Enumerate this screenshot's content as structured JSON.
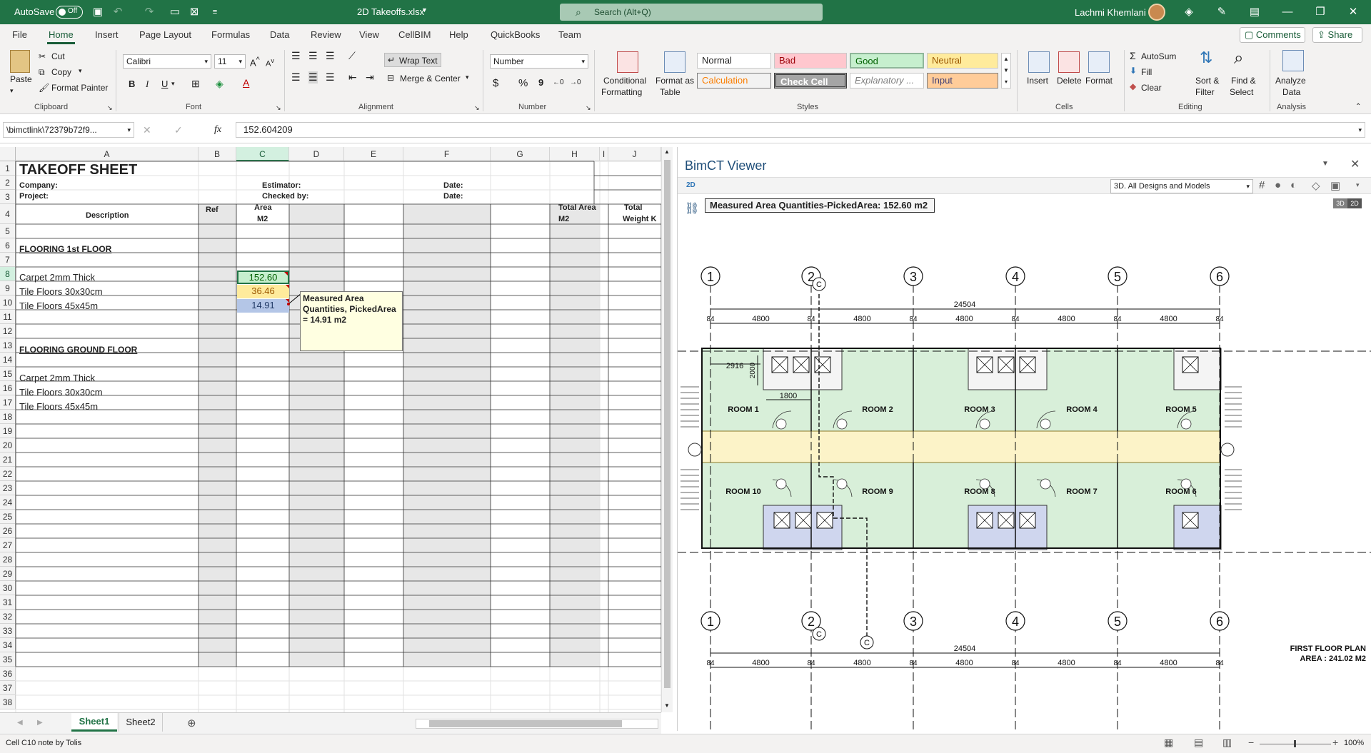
{
  "titlebar": {
    "autosave_label": "AutoSave",
    "autosave_state": "Off",
    "filename": "2D Takeoffs.xlsx",
    "search_placeholder": "Search (Alt+Q)",
    "user_name": "Lachmi Khemlani"
  },
  "ribbon_tabs": [
    "File",
    "Home",
    "Insert",
    "Page Layout",
    "Formulas",
    "Data",
    "Review",
    "View",
    "CellBIM",
    "Help",
    "QuickBooks",
    "Team"
  ],
  "ribbon_right": {
    "comments": "Comments",
    "share": "Share"
  },
  "clipboard": {
    "paste": "Paste",
    "cut": "Cut",
    "copy": "Copy",
    "format_painter": "Format Painter",
    "group": "Clipboard"
  },
  "font": {
    "name": "Calibri",
    "size": "11",
    "bold": "B",
    "italic": "I",
    "underline": "U",
    "group": "Font"
  },
  "alignment": {
    "wrap_text": "Wrap Text",
    "merge_center": "Merge & Center",
    "group": "Alignment"
  },
  "number": {
    "format": "Number",
    "currency": "$",
    "percent": "%",
    "comma": "9",
    "group": "Number"
  },
  "styles": {
    "conditional_1": "Conditional",
    "conditional_2": "Formatting",
    "format_as_1": "Format as",
    "format_as_2": "Table",
    "normal": "Normal",
    "bad": "Bad",
    "good": "Good",
    "neutral": "Neutral",
    "calculation": "Calculation",
    "check_cell": "Check Cell",
    "explanatory": "Explanatory ...",
    "input": "Input",
    "group": "Styles"
  },
  "cells_group": {
    "insert": "Insert",
    "delete": "Delete",
    "format": "Format",
    "group": "Cells"
  },
  "editing": {
    "autosum": "AutoSum",
    "fill": "Fill",
    "clear": "Clear",
    "sort_1": "Sort &",
    "sort_2": "Filter",
    "find_1": "Find &",
    "find_2": "Select",
    "group": "Editing"
  },
  "analysis": {
    "analyze_1": "Analyze",
    "analyze_2": "Data",
    "group": "Analysis"
  },
  "formula_bar": {
    "name_box": "\\bimctlink\\72379b72f9...",
    "fx": "fx",
    "value": "152.604209"
  },
  "columns": [
    "A",
    "B",
    "C",
    "D",
    "E",
    "F",
    "G",
    "H",
    "I",
    "J"
  ],
  "rows": [
    "1",
    "2",
    "3",
    "4",
    "5",
    "6",
    "7",
    "8",
    "9",
    "10",
    "11",
    "12",
    "13",
    "14",
    "15",
    "16",
    "17",
    "18",
    "19",
    "20",
    "21",
    "22",
    "23",
    "24",
    "25",
    "26",
    "27",
    "28",
    "29",
    "30",
    "31",
    "32",
    "33",
    "34",
    "35",
    "36",
    "37",
    "38"
  ],
  "sheet": {
    "title": "TAKEOFF SHEET",
    "company": "Company:",
    "project": "Project:",
    "estimator": "Estimator:",
    "checked_by": "Checked by:",
    "date1": "Date:",
    "date2": "Date:",
    "hdr_description": "Description",
    "hdr_ref": "Ref",
    "hdr_area_1": "Area",
    "hdr_area_2": "M2",
    "hdr_total_area_1": "Total Area",
    "hdr_total_area_2": "M2",
    "hdr_total_weight_1": "Total",
    "hdr_total_weight_2": "Weight K",
    "section1": "FLOORING 1st FLOOR",
    "item1": "Carpet 2mm Thick",
    "item2": "Tile Floors 30x30cm",
    "item3": "Tile Floors 45x45m",
    "val1": "152.60",
    "val2": "36.46",
    "val3": "14.91",
    "section2": "FLOORING GROUND FLOOR",
    "item4": "Carpet 2mm Thick",
    "item5": "Tile Floors 30x30cm",
    "item6": "Tile Floors 45x45m",
    "comment": "Measured Area Quantities, PickedArea = 14.91 m2"
  },
  "sheet_tabs": [
    "Sheet1",
    "Sheet2"
  ],
  "status": {
    "left": "Cell C10 note by Tolis",
    "zoom": "100%"
  },
  "viewer": {
    "title": "BimCT Viewer",
    "mode": "2D",
    "view_select": "3D. All Designs and Models",
    "measure_label": "Measured Area Quantities-PickedArea: 152.60 m2",
    "toggle_3d": "3D",
    "toggle_2d": "2D",
    "grid_labels": [
      "1",
      "2",
      "3",
      "4",
      "5",
      "6"
    ],
    "overall_dim": "24504",
    "bay_dim": "4800",
    "small_dim": "84",
    "dim_2916": "2916",
    "dim_2000": "2000",
    "dim_1800": "1800",
    "rooms_top": [
      "ROOM 1",
      "ROOM 2",
      "ROOM 3",
      "ROOM 4",
      "ROOM 5"
    ],
    "rooms_bottom": [
      "ROOM 10",
      "ROOM 9",
      "ROOM 8",
      "ROOM 7",
      "ROOM 6"
    ],
    "section_mark": "C",
    "plan_title": "FIRST FLOOR PLAN",
    "plan_area": "AREA : 241.02 M2"
  },
  "colors": {
    "excel_green": "#217346",
    "good_fill": "#c6efce",
    "neutral_fill": "#ffeb9c",
    "bad_fill": "#ffc7ce",
    "room_green": "#d8efd9",
    "corridor_yellow": "#fcf3c8",
    "wc_blue": "#cfd6ee"
  }
}
